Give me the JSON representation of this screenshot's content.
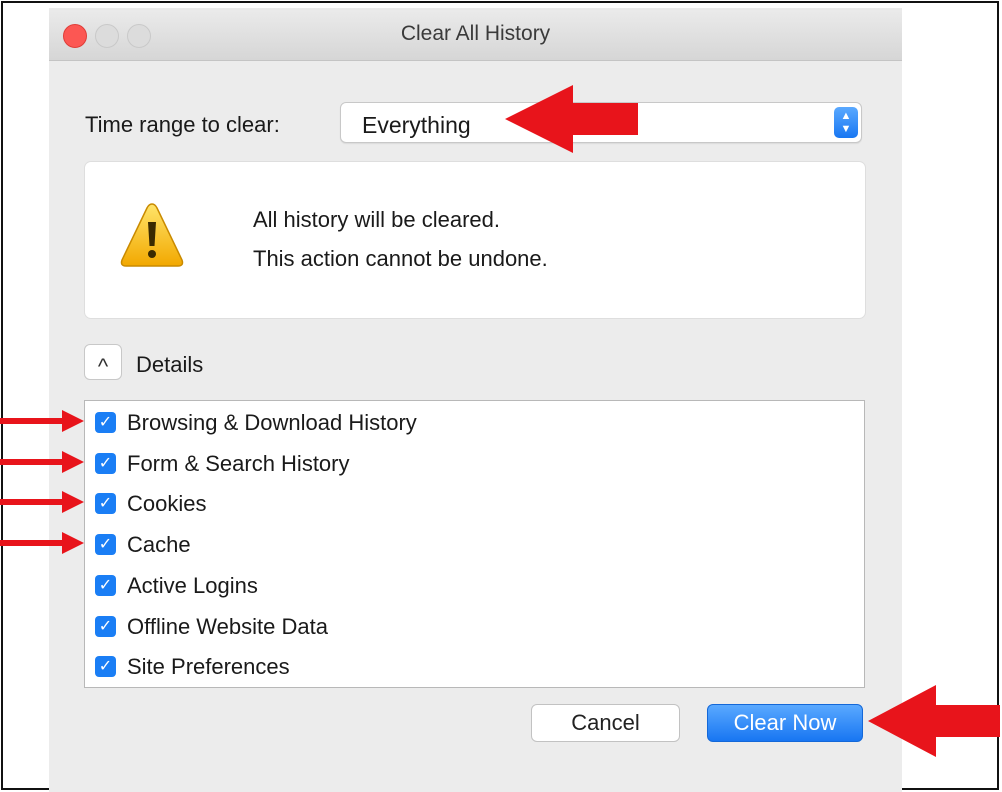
{
  "window": {
    "title": "Clear All History"
  },
  "time_range": {
    "label": "Time range to clear:",
    "value": "Everything"
  },
  "warning": {
    "line1": "All history will be cleared.",
    "line2": "This action cannot be undone."
  },
  "details": {
    "label": "Details",
    "toggle_glyph": "^"
  },
  "items": [
    {
      "label": "Browsing & Download History",
      "checked": true
    },
    {
      "label": "Form & Search History",
      "checked": true
    },
    {
      "label": "Cookies",
      "checked": true
    },
    {
      "label": "Cache",
      "checked": true
    },
    {
      "label": "Active Logins",
      "checked": true
    },
    {
      "label": "Offline Website Data",
      "checked": true
    },
    {
      "label": "Site Preferences",
      "checked": true
    }
  ],
  "buttons": {
    "cancel": "Cancel",
    "clear_now": "Clear Now"
  },
  "colors": {
    "accent": "#1a7ef5",
    "annotation_arrow": "#e8141b",
    "close_light": "#fc5753"
  }
}
